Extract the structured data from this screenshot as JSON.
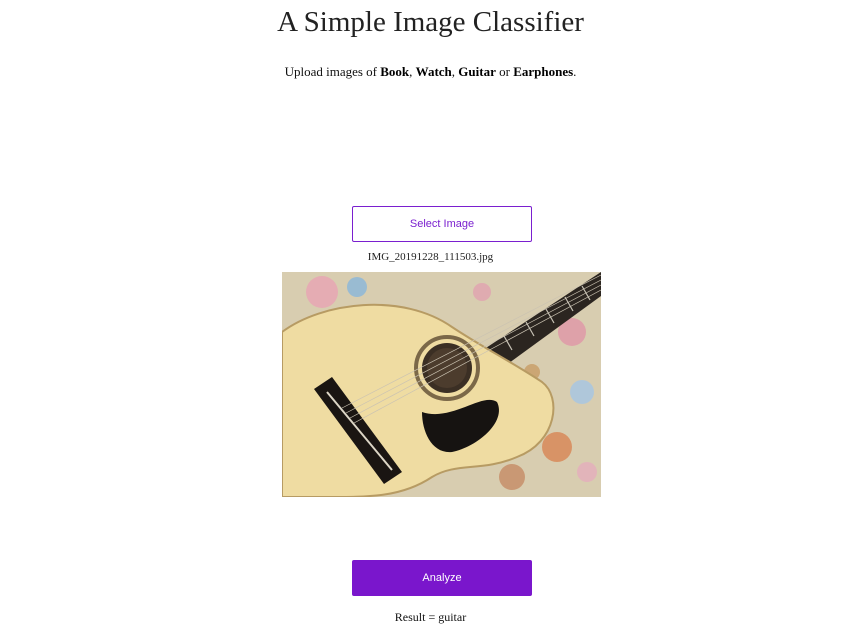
{
  "header": {
    "title": "A Simple Image Classifier",
    "subtitle_prefix": "Upload images of ",
    "classes": [
      "Book",
      "Watch",
      "Guitar",
      "Earphones"
    ],
    "sep_comma": ", ",
    "sep_or": " or ",
    "subtitle_suffix": "."
  },
  "upload": {
    "select_label": "Select Image",
    "filename": "IMG_20191228_111503.jpg"
  },
  "preview": {
    "description_icon": "guitar-photo",
    "image_alt": "Uploaded image"
  },
  "actions": {
    "analyze_label": "Analyze"
  },
  "result": {
    "text": "Result = guitar"
  },
  "colors": {
    "accent": "#7a16cc",
    "text": "#222222",
    "background": "#ffffff"
  }
}
